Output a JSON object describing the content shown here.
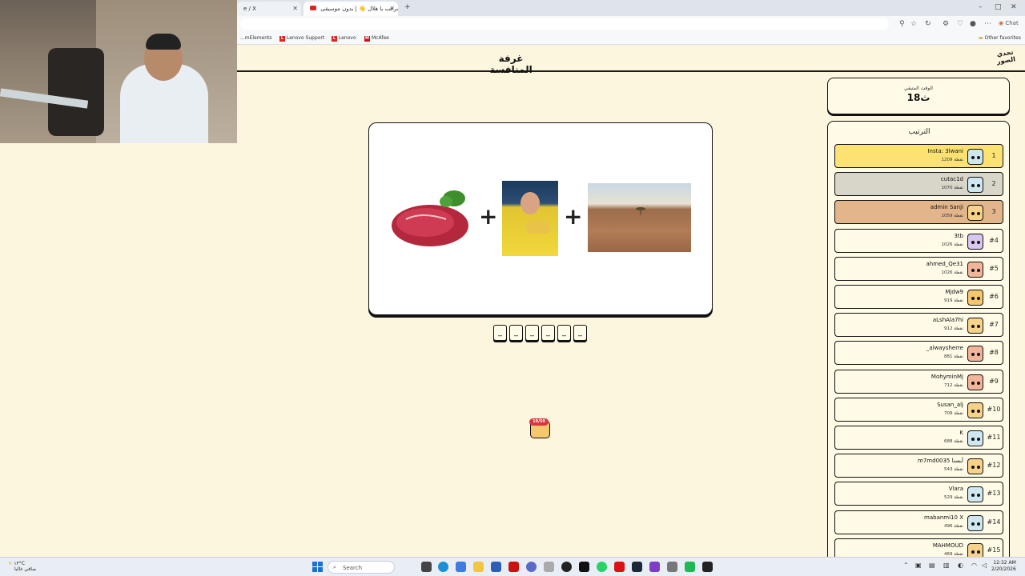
{
  "browser": {
    "tabs": [
      {
        "label": "e / X"
      },
      {
        "label": "مرحب يا هلال 👋 | بدون موسيقى"
      }
    ],
    "new_tab": "+",
    "window_controls": {
      "min": "–",
      "max": "□",
      "close": "✕"
    },
    "chat_label": "Chat",
    "other_favorites": "Other favorites",
    "bookmarks": [
      {
        "label": "...mElements"
      },
      {
        "label": "Lenovo Support"
      },
      {
        "label": "Lenovo"
      },
      {
        "label": "McAfee"
      }
    ]
  },
  "header": {
    "title": "غرفة المنافسة",
    "logo_text": "تحدي الصور"
  },
  "puzzle": {
    "plus_symbol": "+",
    "letter_slots": [
      "_",
      "_",
      "_",
      "_",
      "_",
      "_"
    ],
    "icons": [
      "meat-image",
      "goalkeeper-image",
      "desert-land-image"
    ]
  },
  "mascot": {
    "badge": "10/50"
  },
  "timer": {
    "label": "الوقت المتبقي",
    "value": "18ث"
  },
  "ranking": {
    "title": "الترتيب",
    "rows": [
      {
        "rank": "1",
        "name": "Insta: 3lwani",
        "points": "1209 نقطة",
        "color": "#fce273",
        "ava": "#cfe7ef"
      },
      {
        "rank": "2",
        "name": "cutac1d",
        "points": "1070 نقطة",
        "color": "#d8d6c9",
        "ava": "#cfe7ef"
      },
      {
        "rank": "3",
        "name": "admin Sanji",
        "points": "1059 نقطة",
        "color": "#e3b58a",
        "ava": "#f6d28a"
      },
      {
        "rank": "#4",
        "name": "3tb",
        "points": "1026 نقطة",
        "color": "#fffbe6",
        "ava": "#d8c7ef"
      },
      {
        "rank": "#5",
        "name": "ahmed_Qe31",
        "points": "1026 نقطة",
        "color": "#fffbe6",
        "ava": "#f2b59a"
      },
      {
        "rank": "#6",
        "name": "Mjdw9",
        "points": "919 نقطة",
        "color": "#fffbe6",
        "ava": "#f6c86d"
      },
      {
        "rank": "#7",
        "name": "aLshAla7hi",
        "points": "912 نقطة",
        "color": "#fffbe6",
        "ava": "#f6d28a"
      },
      {
        "rank": "#8",
        "name": "_alwaysherre",
        "points": "881 نقطة",
        "color": "#fffbe6",
        "ava": "#f2b59a"
      },
      {
        "rank": "#9",
        "name": "MohyminMj",
        "points": "712 نقطة",
        "color": "#fffbe6",
        "ava": "#f2b59a"
      },
      {
        "rank": "#10",
        "name": "Susan_alj",
        "points": "709 نقطة",
        "color": "#fffbe6",
        "ava": "#f6d28a"
      },
      {
        "rank": "#11",
        "name": "K",
        "points": "688 نقطة",
        "color": "#fffbe6",
        "ava": "#cfe7ef"
      },
      {
        "rank": "#12",
        "name": "m7md0035 أبسنا",
        "points": "543 نقطة",
        "color": "#fffbe6",
        "ava": "#f6d28a"
      },
      {
        "rank": "#13",
        "name": "Vlara",
        "points": "529 نقطة",
        "color": "#fffbe6",
        "ava": "#cfe7ef"
      },
      {
        "rank": "#14",
        "name": "mabanmi10 X",
        "points": "496 نقطة",
        "color": "#fffbe6",
        "ava": "#cfe7ef"
      },
      {
        "rank": "#15",
        "name": "MAHMOUD",
        "points": "469 نقطة",
        "color": "#fffbe6",
        "ava": "#f6d28a"
      }
    ]
  },
  "taskbar": {
    "weather_temp": "١٣°C",
    "weather_desc": "صافي غالبا",
    "search_placeholder": "Search",
    "clock_time": "12:32 AM",
    "clock_date": "2/20/2026"
  }
}
